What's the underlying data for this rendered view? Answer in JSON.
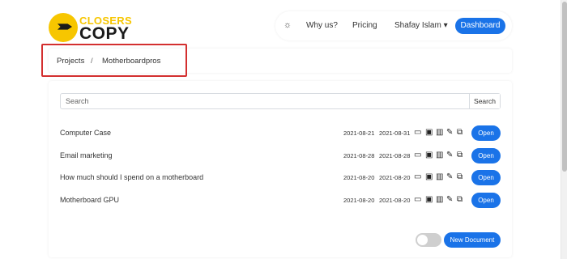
{
  "brand": {
    "line1": "CLOSERS",
    "line2": "COPY",
    "accent_color": "#f7c600"
  },
  "nav": {
    "theme_icon": "sun-icon",
    "why_label": "Why us?",
    "pricing_label": "Pricing",
    "user_label": "Shafay Islam",
    "user_caret": "▾",
    "dashboard_label": "Dashboard"
  },
  "breadcrumb": {
    "items": [
      "Projects",
      "Motherboardpros"
    ],
    "separator": "/"
  },
  "search": {
    "placeholder": "Search",
    "button_label": "Search"
  },
  "documents": [
    {
      "name": "Computer Case",
      "created": "2021-08-21",
      "updated": "2021-08-31",
      "open_label": "Open"
    },
    {
      "name": "Email marketing",
      "created": "2021-08-28",
      "updated": "2021-08-28",
      "open_label": "Open"
    },
    {
      "name": "How much should I spend on a motherboard",
      "created": "2021-08-20",
      "updated": "2021-08-20",
      "open_label": "Open"
    },
    {
      "name": "Motherboard GPU",
      "created": "2021-08-20",
      "updated": "2021-08-20",
      "open_label": "Open"
    }
  ],
  "row_icons": [
    "folder-icon",
    "archive-icon",
    "trash-icon",
    "edit-icon",
    "copy-icon"
  ],
  "footer": {
    "new_document_label": "New Document"
  },
  "colors": {
    "primary": "#1a73e8",
    "highlight": "#d32f2f"
  }
}
